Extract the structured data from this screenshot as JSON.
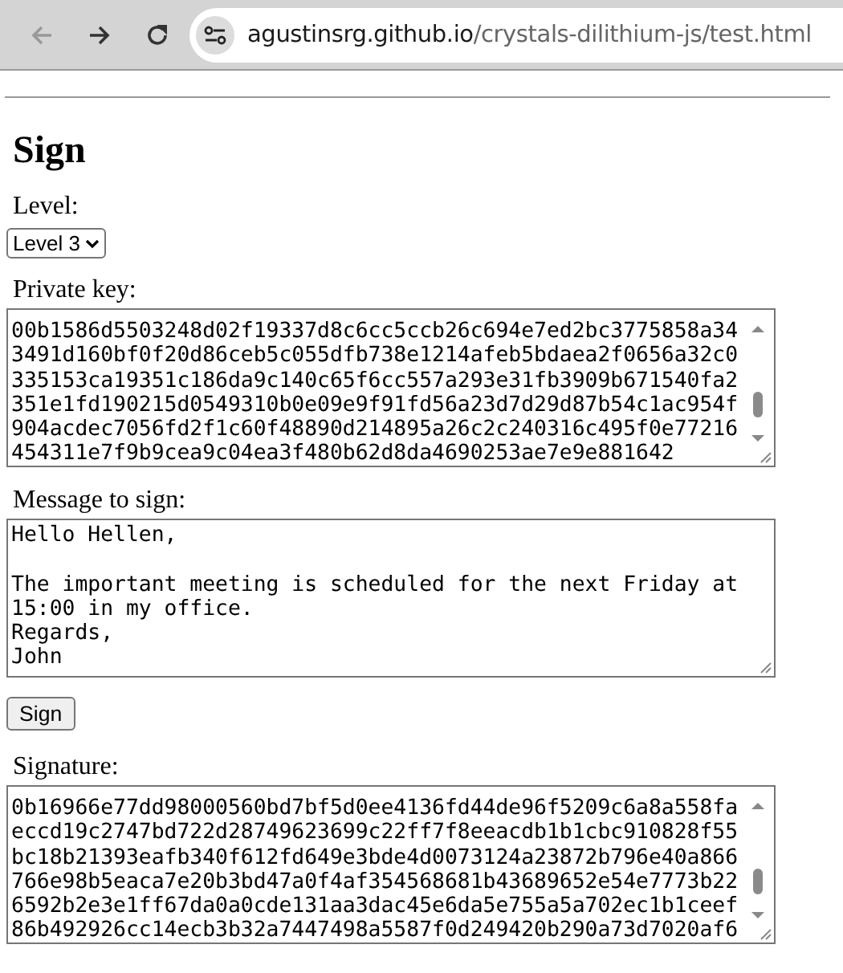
{
  "browser": {
    "nav_buttons": [
      {
        "kind": "back",
        "disabled": true
      },
      {
        "kind": "forward",
        "disabled": false
      },
      {
        "kind": "reload",
        "disabled": false
      }
    ],
    "url": {
      "domain": "agustinsrg.github.io",
      "path": "/crystals-dilithium-js/test.html"
    }
  },
  "page": {
    "heading": "Sign",
    "level": {
      "label": "Level:",
      "value": "Level 3"
    },
    "private_key": {
      "label": "Private key:",
      "lines": [
        "00b1586d5503248d02f19337d8c6cc5ccb26c694e7ed2bc3775858a34",
        "3491d160bf0f20d86ceb5c055dfb738e1214afeb5bdaea2f0656a32c0",
        "335153ca19351c186da9c140c65f6cc557a293e31fb3909b671540fa2",
        "351e1fd190215d0549310b0e09e9f91fd56a23d7d29d87b54c1ac954f",
        "904acdec7056fd2f1c60f48890d214895a26c2c240316c495f0e77216",
        "454311e7f9b9cea9c04ea3f480b62d8da4690253ae7e9e881642"
      ]
    },
    "message": {
      "label": "Message to sign:",
      "value": "Hello Hellen,\n\nThe important meeting is scheduled for the next Friday at\n15:00 in my office.\nRegards,\nJohn"
    },
    "sign_button": "Sign",
    "signature": {
      "label": "Signature:",
      "lines": [
        "0b16966e77dd98000560bd7bf5d0ee4136fd44de96f5209c6a8a558fa",
        "eccd19c2747bd722d28749623699c22ff7f8eeacdb1b1cbc910828f55",
        "bc18b21393eafb340f612fd649e3bde4d0073124a23872b796e40a866",
        "766e98b5eaca7e20b3bd47a0f4af354568681b43689652e54e7773b22",
        "6592b2e3e1ff67da0a0cde131aa3dac45e6da5e755a5a702ec1b1ceef",
        "86b492926cc14ecb3b32a7447498a5587f0d249420b290a73d7020af6"
      ]
    }
  }
}
